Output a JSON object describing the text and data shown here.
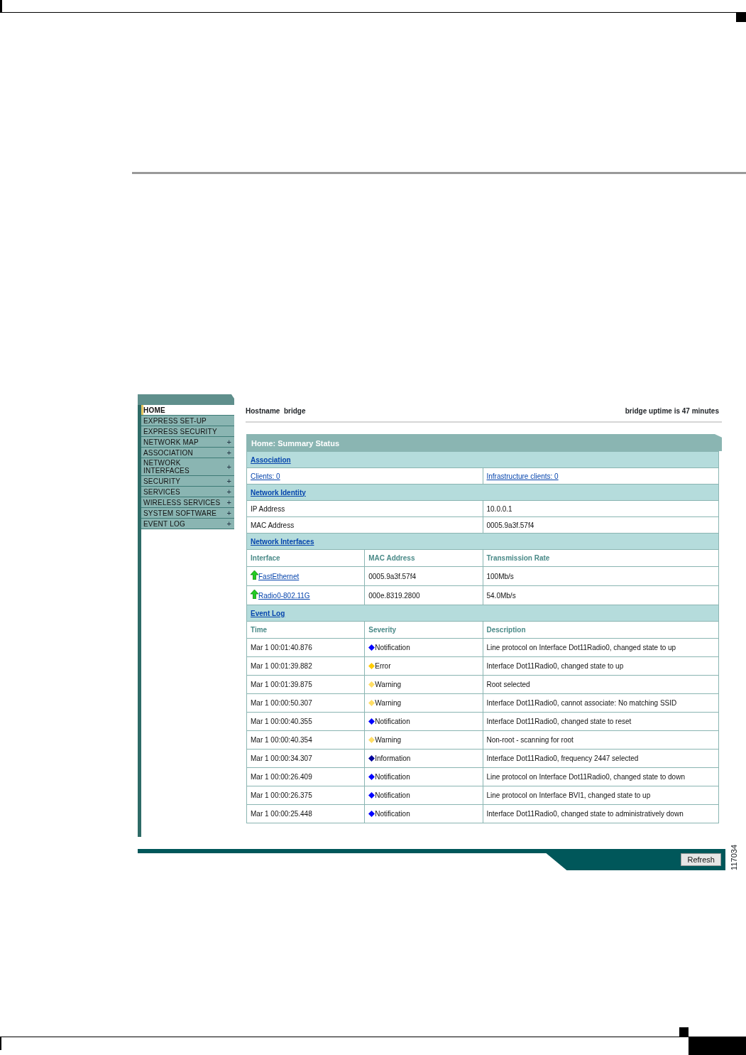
{
  "sidebar": {
    "items": [
      {
        "label": "HOME",
        "selected": true
      },
      {
        "label": "EXPRESS SET-UP",
        "selected": false
      },
      {
        "label": "EXPRESS SECURITY",
        "selected": false
      },
      {
        "label": "NETWORK MAP",
        "selected": false,
        "toggle": "+"
      },
      {
        "label": "ASSOCIATION",
        "selected": false,
        "toggle": "+"
      },
      {
        "label": "NETWORK\nINTERFACES",
        "selected": false,
        "toggle": "+"
      },
      {
        "label": "SECURITY",
        "selected": false,
        "toggle": "+"
      },
      {
        "label": "SERVICES",
        "selected": false,
        "toggle": "+"
      },
      {
        "label": "WIRELESS SERVICES",
        "selected": false,
        "toggle": "+"
      },
      {
        "label": "SYSTEM SOFTWARE",
        "selected": false,
        "toggle": "+"
      },
      {
        "label": "EVENT LOG",
        "selected": false,
        "toggle": "+"
      }
    ]
  },
  "header": {
    "hostname": "Hostname  bridge",
    "uptime": "bridge uptime is 47 minutes"
  },
  "panel": {
    "title": "Home: Summary Status",
    "sections": [
      {
        "kind": "links",
        "heading": "Association",
        "items": [
          "Clients: 0",
          "Infrastructure clients: 0"
        ]
      },
      {
        "kind": "pairs",
        "heading": "Network Identity",
        "rows": [
          {
            "label": "IP Address",
            "value": "10.0.0.1"
          },
          {
            "label": "MAC Address",
            "value": "0005.9a3f.57f4"
          }
        ]
      },
      {
        "kind": "interfaces",
        "heading": "Network Interfaces",
        "columns": [
          "Interface",
          "MAC Address",
          "Transmission Rate"
        ],
        "rows": [
          {
            "name": "FastEthernet",
            "up": true,
            "mac": "0005.9a3f.57f4",
            "rate": "100Mb/s"
          },
          {
            "name": "Radio0-802.11G",
            "up": true,
            "mac": "000e.8319.2800",
            "rate": "54.0Mb/s"
          }
        ]
      },
      {
        "kind": "events",
        "heading": "Event Log",
        "columns": [
          "Time",
          "Severity",
          "Description"
        ],
        "rows": [
          {
            "time": "Mar 1 00:01:40.876",
            "severity": "Notification",
            "color": "#0000ff",
            "description": "Line protocol on Interface Dot11Radio0, changed state to up"
          },
          {
            "time": "Mar 1 00:01:39.882",
            "severity": "Error",
            "color": "#ffcc00",
            "description": "Interface Dot11Radio0, changed state to up"
          },
          {
            "time": "Mar 1 00:01:39.875",
            "severity": "Warning",
            "color": "#ffdd66",
            "description": "Root selected"
          },
          {
            "time": "Mar 1 00:00:50.307",
            "severity": "Warning",
            "color": "#ffdd66",
            "description": "Interface Dot11Radio0, cannot associate: No matching SSID"
          },
          {
            "time": "Mar 1 00:00:40.355",
            "severity": "Notification",
            "color": "#0000ff",
            "description": "Interface Dot11Radio0, changed state to reset"
          },
          {
            "time": "Mar 1 00:00:40.354",
            "severity": "Warning",
            "color": "#ffdd66",
            "description": "Non-root - scanning for root"
          },
          {
            "time": "Mar 1 00:00:34.307",
            "severity": "Information",
            "color": "#000099",
            "description": "Interface Dot11Radio0, frequency 2447 selected"
          },
          {
            "time": "Mar 1 00:00:26.409",
            "severity": "Notification",
            "color": "#0000ff",
            "description": "Line protocol on Interface Dot11Radio0, changed state to down"
          },
          {
            "time": "Mar 1 00:00:26.375",
            "severity": "Notification",
            "color": "#0000ff",
            "description": "Line protocol on Interface BVI1, changed state to up"
          },
          {
            "time": "Mar 1 00:00:25.448",
            "severity": "Notification",
            "color": "#0000ff",
            "description": "Interface Dot11Radio0, changed state to administratively down"
          }
        ]
      }
    ]
  },
  "refresh_button": "Refresh",
  "figure_number": "117034"
}
